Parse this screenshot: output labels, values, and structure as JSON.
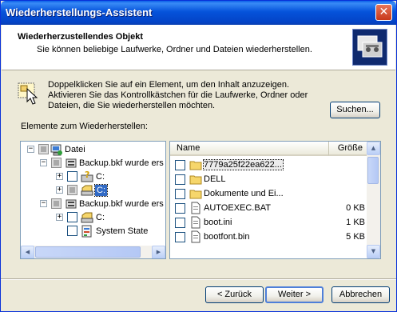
{
  "window": {
    "title": "Wiederherstellungs-Assistent",
    "close_glyph": "✕"
  },
  "header": {
    "title": "Wiederherzustellendes Objekt",
    "subtitle": "Sie können beliebige Laufwerke, Ordner und Dateien wiederherstellen.",
    "logo_icon": "backup-restore-icon"
  },
  "info": {
    "icon": "cursor-select-icon",
    "text": "Doppelklicken Sie auf ein Element, um den Inhalt anzuzeigen. Aktivieren Sie das Kontrollkästchen für die Laufwerke, Ordner oder Dateien, die Sie wiederherstellen möchten."
  },
  "search_button": "Suchen...",
  "elements_label": "Elemente zum Wiederherstellen:",
  "tree": [
    {
      "label": "Datei",
      "icon": "computer-icon",
      "expander": "−",
      "checkbox": "partial"
    },
    {
      "label": "Backup.bkf wurde ers",
      "icon": "backup-media-icon",
      "expander": "−",
      "checkbox": "partial"
    },
    {
      "label": "C:",
      "icon": "drive-question-icon",
      "expander": "+",
      "checkbox": "empty"
    },
    {
      "label": "C:",
      "icon": "drive-icon",
      "expander": "+",
      "checkbox": "partial",
      "selected": true
    },
    {
      "label": "Backup.bkf wurde ers",
      "icon": "backup-media-icon",
      "expander": "−",
      "checkbox": "partial"
    },
    {
      "label": "C:",
      "icon": "drive-icon",
      "expander": "+",
      "checkbox": "empty"
    },
    {
      "label": "System State",
      "icon": "system-state-icon",
      "expander": "",
      "checkbox": "empty"
    }
  ],
  "list": {
    "columns": {
      "name": "Name",
      "size": "Größe"
    },
    "rows": [
      {
        "name": "7779a25f22ea622...",
        "size": "",
        "icon": "folder-icon",
        "focused": true
      },
      {
        "name": "DELL",
        "size": "",
        "icon": "folder-icon"
      },
      {
        "name": "Dokumente und Ei...",
        "size": "",
        "icon": "folder-icon"
      },
      {
        "name": "AUTOEXEC.BAT",
        "size": "0 KB",
        "icon": "file-icon"
      },
      {
        "name": "boot.ini",
        "size": "1 KB",
        "icon": "file-icon"
      },
      {
        "name": "bootfont.bin",
        "size": "5 KB",
        "icon": "file-icon"
      }
    ]
  },
  "footer": {
    "back": "< Zurück",
    "next": "Weiter >",
    "cancel": "Abbrechen"
  },
  "colors": {
    "titlebar": "#0553DB",
    "selection": "#316AC5",
    "dialog_bg": "#ECE9D8"
  }
}
